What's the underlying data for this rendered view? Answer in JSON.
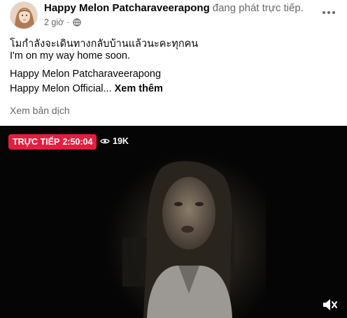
{
  "post": {
    "author": "Happy Melon Patcharaveerapong",
    "action": "đang phát trực tiếp.",
    "time": "2 giờ",
    "privacy_icon": "globe-icon",
    "lines": [
      "โมกำลังจะเดินทางกลับบ้านแล้วนะคะทุกคน",
      "I'm on my way home soon."
    ],
    "line3": "Happy Melon Patcharaveerapong",
    "line4": "Happy Melon Official...",
    "see_more": "Xem thêm",
    "translate": "Xem bản dịch"
  },
  "video": {
    "live_label": "TRỰC TIẾP",
    "live_time": "2:50:04",
    "viewers": "19K",
    "live_color": "#e41e3f"
  }
}
